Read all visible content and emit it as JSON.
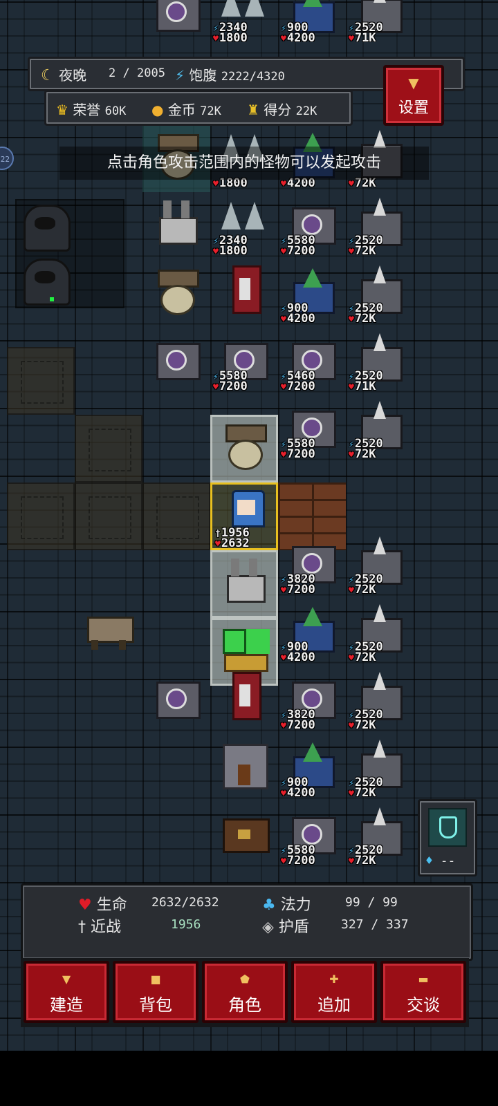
{
  "hud": {
    "phase_label": "夜晚",
    "turn": "2",
    "turn_sep": "/",
    "turn_max": "2005",
    "hunger_label": "饱腹",
    "hunger_value": "2222/4320",
    "honor_label": "荣誉",
    "honor_value": "60K",
    "gold_label": "金币",
    "gold_value": "72K",
    "score_label": "得分",
    "score_value": "22K",
    "settings_label": "设置",
    "edge_badge": "22"
  },
  "hint": "点击角色攻击范围内的怪物可以发起攻击",
  "stats": {
    "s2340": "2340",
    "s1800": "1800",
    "s900": "900",
    "s4200": "4200",
    "s2520": "2520",
    "s71K": "71K",
    "s72K": "72K",
    "s5580": "5580",
    "s7200": "7200",
    "s5460": "5460",
    "s3820": "3820",
    "hero_atk": "1956",
    "hero_hp": "2632"
  },
  "potion": {
    "qty": "--"
  },
  "status": {
    "hp_label": "生命",
    "hp_value": "2632/2632",
    "mp_label": "法力",
    "mp_value": "99 / 99",
    "melee_label": "近战",
    "melee_value": "1956",
    "shield_label": "护盾",
    "shield_value": "327 / 337"
  },
  "actions": {
    "build": "建造",
    "bag": "背包",
    "role": "角色",
    "add": "追加",
    "talk": "交谈"
  },
  "icons": {
    "phase": "moon-icon",
    "hunger": "bolt-icon",
    "honor": "crown-icon",
    "gold": "coin-icon",
    "score": "trophy-icon",
    "settings": "hammer-icon",
    "hp": "heart-icon",
    "mp": "potion-icon",
    "melee": "sword-icon",
    "shield": "shield-icon"
  },
  "colors": {
    "accent_red": "#9a0e16",
    "panel": "#2a2d32",
    "hero_outline": "#e8c020"
  }
}
